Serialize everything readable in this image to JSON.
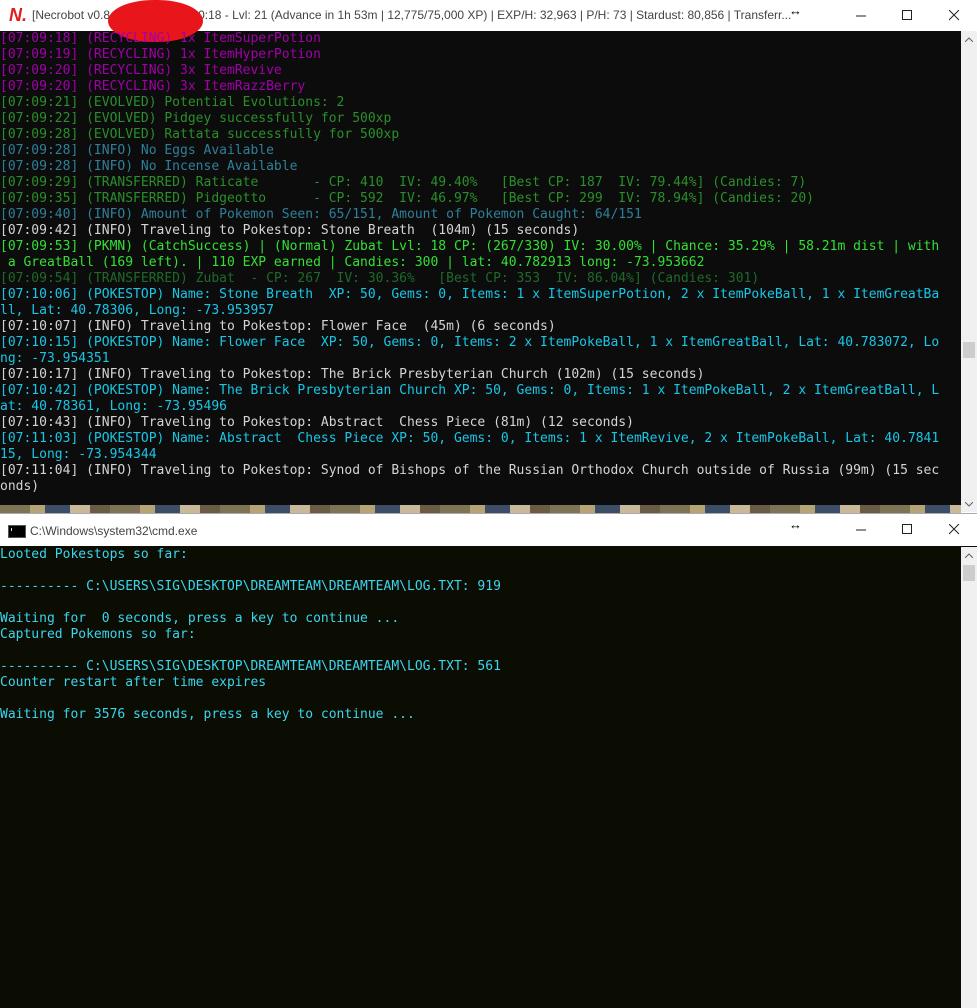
{
  "necrobot": {
    "title": "[Necrobot v0.8…  ntime 00.07:40:18 - Lvl: 21 (Advance in 1h 53m | 12,775/75,000 XP) | EXP/H: 32,963 | P/H: 73 | Stardust: 80,856 | Transferr...",
    "icon": "necrobot-logo-icon",
    "lines": [
      {
        "text": "[07:09:18] (RECYCLING) 1x ItemSuperPotion",
        "kind": "recycle"
      },
      {
        "text": "[07:09:19] (RECYCLING) 1x ItemHyperPotion",
        "kind": "recycle"
      },
      {
        "text": "[07:09:20] (RECYCLING) 3x ItemRevive",
        "kind": "recycle"
      },
      {
        "text": "[07:09:20] (RECYCLING) 3x ItemRazzBerry",
        "kind": "recycle"
      },
      {
        "text": "[07:09:21] (EVOLVED) Potential Evolutions: 2",
        "kind": "evolve"
      },
      {
        "text": "[07:09:22] (EVOLVED) Pidgey successfully for 500xp",
        "kind": "evolve"
      },
      {
        "text": "[07:09:28] (EVOLVED) Rattata successfully for 500xp",
        "kind": "evolve"
      },
      {
        "text": "[07:09:28] (INFO) No Eggs Available",
        "kind": "info1"
      },
      {
        "text": "[07:09:28] (INFO) No Incense Available",
        "kind": "info1"
      },
      {
        "text": "[07:09:29] (TRANSFERRED) Raticate       - CP: 410  IV: 49.40%   [Best CP: 187  IV: 79.44%] (Candies: 7)",
        "kind": "transfer"
      },
      {
        "text": "[07:09:35] (TRANSFERRED) Pidgeotto      - CP: 592  IV: 46.97%   [Best CP: 299  IV: 78.94%] (Candies: 20)",
        "kind": "transfer"
      },
      {
        "text": "[07:09:40] (INFO) Amount of Pokemon Seen: 65/151, Amount of Pokemon Caught: 64/151",
        "kind": "info1"
      },
      {
        "text": "[07:09:42] (INFO) Traveling to Pokestop: Stone Breath  (104m) (15 seconds)",
        "kind": "white"
      },
      {
        "text": "[07:09:53] (PKMN) (CatchSuccess) | (Normal) Zubat Lvl: 18 CP: (267/330) IV: 30.00% | Chance: 35.29% | 58.21m dist | with",
        "kind": "pkmn"
      },
      {
        "text": " a GreatBall (169 left). | 110 EXP earned | Candies: 300 | lat: 40.782913 long: -73.953662",
        "kind": "pkmn"
      },
      {
        "text": "[07:09:54] (TRANSFERRED) Zubat  - CP: 267  IV: 30.36%   [Best CP: 353  IV: 86.04%] (Candies: 301)",
        "kind": "dim"
      },
      {
        "text": "[07:10:06] (POKESTOP) Name: Stone Breath  XP: 50, Gems: 0, Items: 1 x ItemSuperPotion, 2 x ItemPokeBall, 1 x ItemGreatBa",
        "kind": "poke"
      },
      {
        "text": "ll, Lat: 40.78306, Long: -73.953957",
        "kind": "poke"
      },
      {
        "text": "[07:10:07] (INFO) Traveling to Pokestop: Flower Face  (45m) (6 seconds)",
        "kind": "white"
      },
      {
        "text": "[07:10:15] (POKESTOP) Name: Flower Face  XP: 50, Gems: 0, Items: 2 x ItemPokeBall, 1 x ItemGreatBall, Lat: 40.783072, Lo",
        "kind": "poke"
      },
      {
        "text": "ng: -73.954351",
        "kind": "poke"
      },
      {
        "text": "[07:10:17] (INFO) Traveling to Pokestop: The Brick Presbyterian Church (102m) (15 seconds)",
        "kind": "white"
      },
      {
        "text": "[07:10:42] (POKESTOP) Name: The Brick Presbyterian Church XP: 50, Gems: 0, Items: 1 x ItemPokeBall, 2 x ItemGreatBall, L",
        "kind": "poke"
      },
      {
        "text": "at: 40.78361, Long: -73.95496",
        "kind": "poke"
      },
      {
        "text": "[07:10:43] (INFO) Traveling to Pokestop: Abstract  Chess Piece (81m) (12 seconds)",
        "kind": "white"
      },
      {
        "text": "[07:11:03] (POKESTOP) Name: Abstract  Chess Piece XP: 50, Gems: 0, Items: 1 x ItemRevive, 2 x ItemPokeBall, Lat: 40.7841",
        "kind": "poke"
      },
      {
        "text": "15, Long: -73.954344",
        "kind": "poke"
      },
      {
        "text": "[07:11:04] (INFO) Traveling to Pokestop: Synod of Bishops of the Russian Orthodox Church outside of Russia (99m) (15 sec",
        "kind": "white"
      },
      {
        "text": "onds)",
        "kind": "white"
      }
    ]
  },
  "cmd": {
    "title": "C:\\Windows\\system32\\cmd.exe",
    "icon": "cmd-icon",
    "lines": [
      "Looted Pokestops so far:",
      "",
      "---------- C:\\USERS\\SIG\\DESKTOP\\DREAMTEAM\\DREAMTEAM\\LOG.TXT: 919",
      "",
      "Waiting for  0 seconds, press a key to continue ...",
      "Captured Pokemons so far:",
      "",
      "---------- C:\\USERS\\SIG\\DESKTOP\\DREAMTEAM\\DREAMTEAM\\LOG.TXT: 561",
      "Counter restart after time expires",
      "",
      "Waiting for 3576 seconds, press a key to continue ..."
    ]
  },
  "window_controls": [
    "minimize",
    "maximize",
    "close"
  ],
  "colors": {
    "recycle": "#a000a8",
    "evolve": "#2a8f2a",
    "info": "#2f7f9a",
    "pkmn": "#33e033",
    "pokestop": "#19c6e6",
    "plain": "#d4d4d4",
    "cmd_text": "#3ad5f0"
  }
}
